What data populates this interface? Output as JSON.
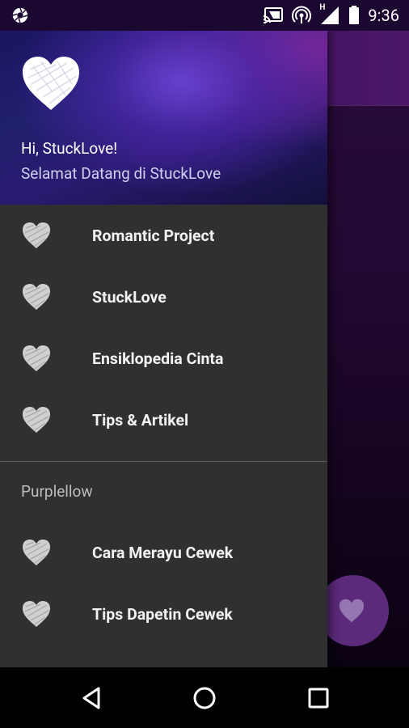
{
  "status_bar": {
    "time": "9:36",
    "network_label": "H",
    "icons": [
      "aperture-icon",
      "cast-icon",
      "hotspot-icon",
      "signal-icon",
      "battery-icon"
    ]
  },
  "drawer": {
    "header": {
      "greeting": "Hi, StuckLove!",
      "subtitle": "Selamat Datang di StuckLove"
    },
    "items": [
      {
        "label": "Romantic Project",
        "icon": "heart-icon"
      },
      {
        "label": "StuckLove",
        "icon": "heart-icon"
      },
      {
        "label": "Ensiklopedia Cinta",
        "icon": "heart-icon"
      },
      {
        "label": "Tips & Artikel",
        "icon": "heart-icon"
      }
    ],
    "section": {
      "title": "Purplellow",
      "items": [
        {
          "label": "Cara Merayu Cewek",
          "icon": "heart-icon"
        },
        {
          "label": "Tips Dapetin Cewek",
          "icon": "heart-icon"
        }
      ]
    }
  },
  "fab": {
    "icon": "heart-icon"
  },
  "nav_bar": {
    "buttons": [
      "back-icon",
      "home-icon",
      "recents-icon"
    ]
  },
  "colors": {
    "drawer_bg": "#303030",
    "accent": "#5b2a7a",
    "status_bar": "#1b0830"
  }
}
